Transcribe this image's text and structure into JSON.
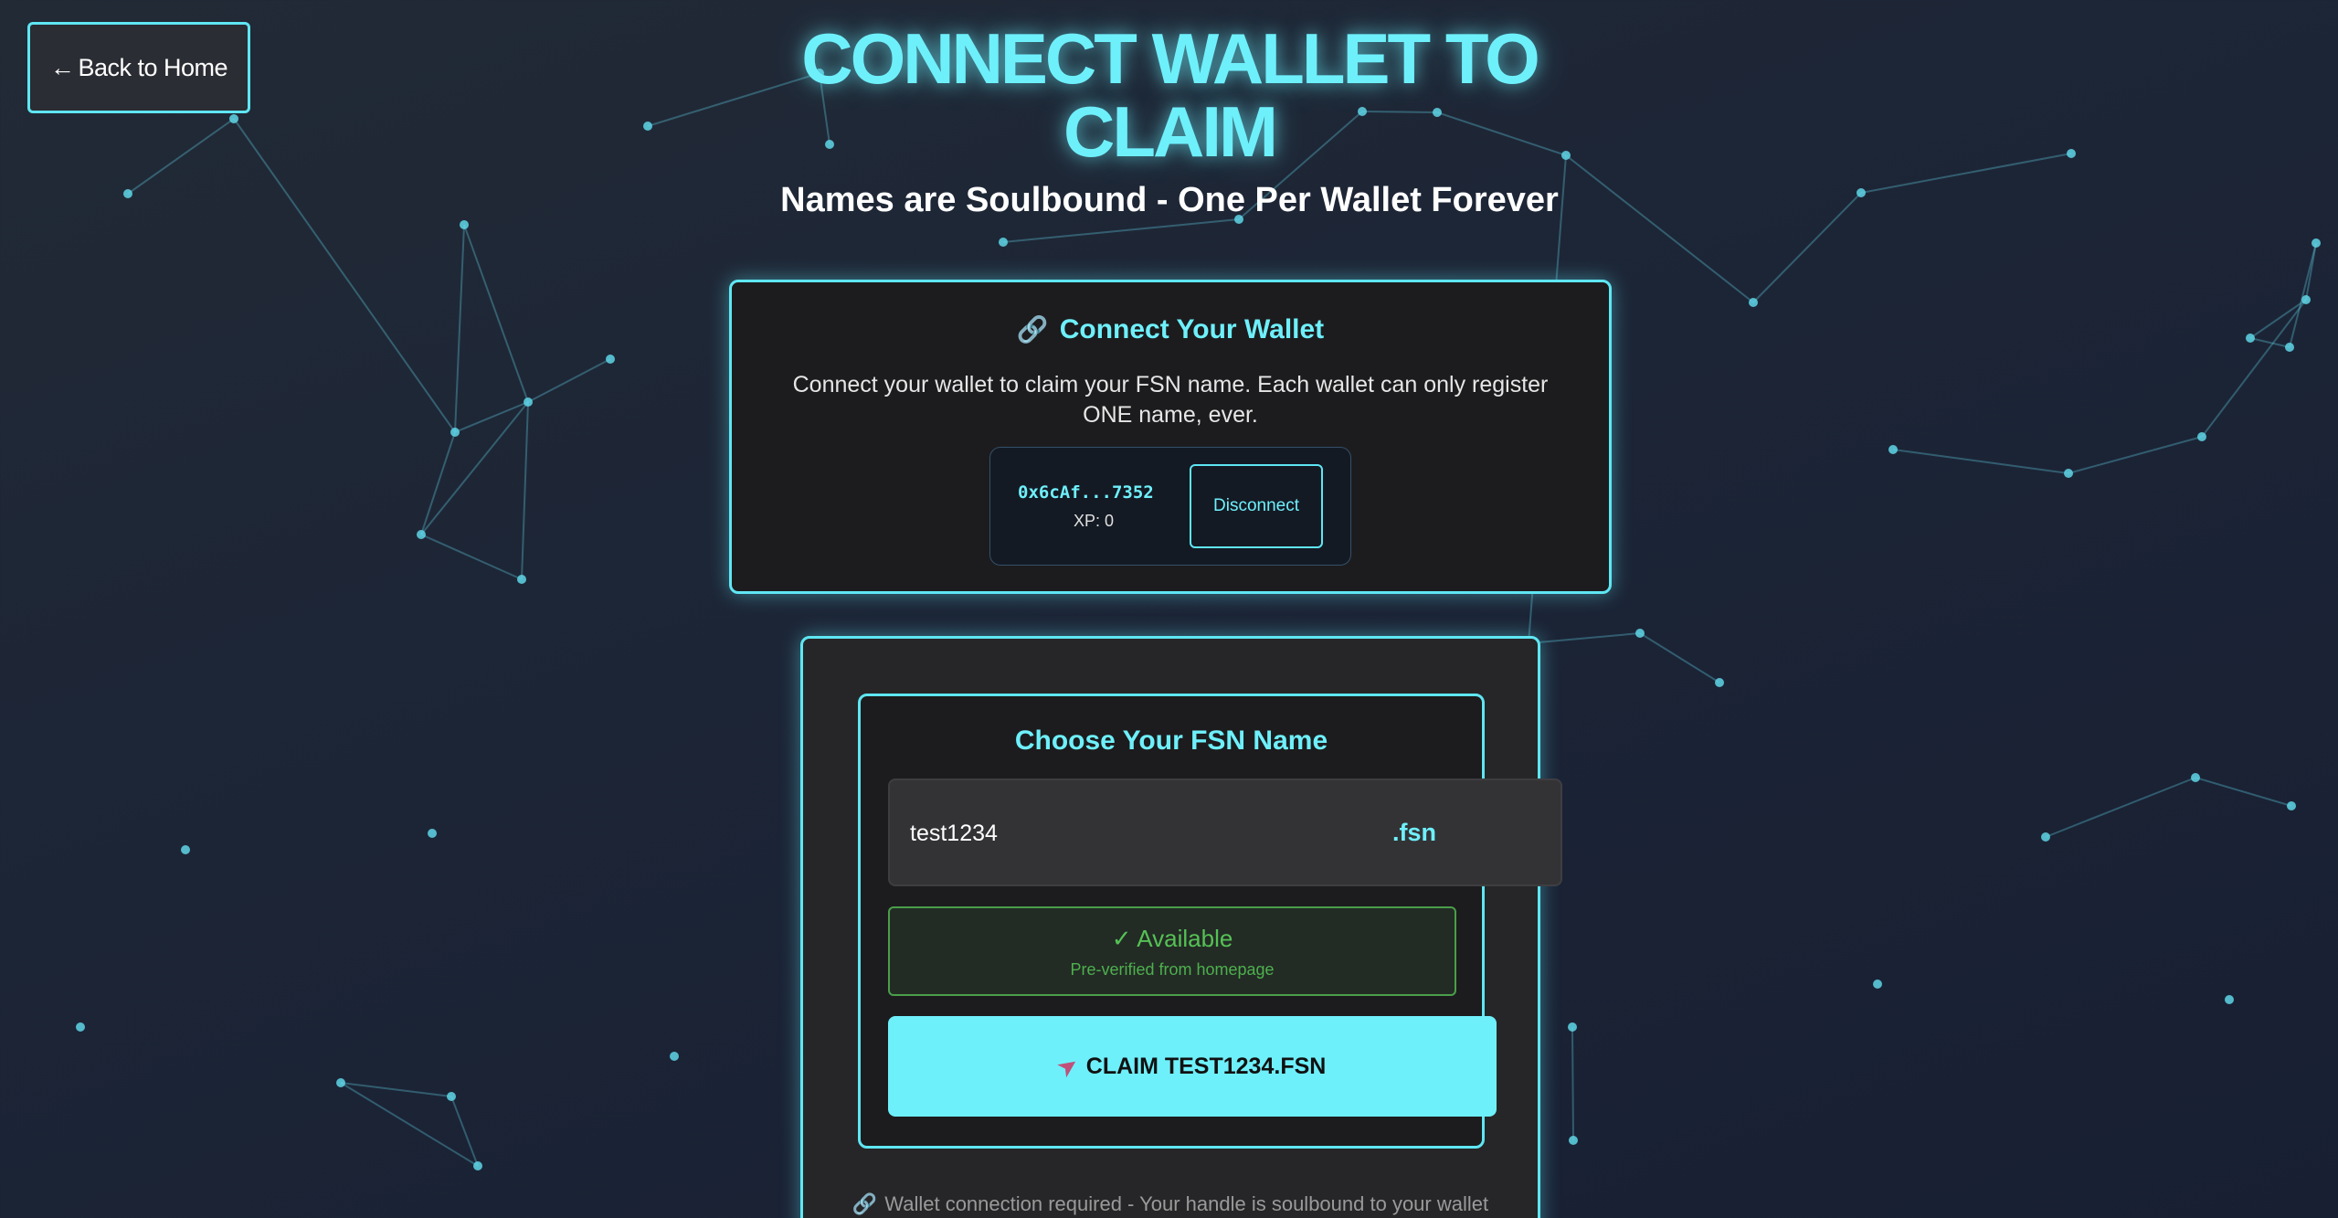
{
  "nav": {
    "back_arrow": "←",
    "back_label": "Back to Home"
  },
  "header": {
    "title": "CONNECT WALLET TO CLAIM",
    "subtitle": "Names are Soulbound - One Per Wallet Forever"
  },
  "wallet": {
    "icon": "link-icon",
    "heading": "Connect Your Wallet",
    "description": "Connect your wallet to claim your FSN name. Each wallet can only register ONE name, ever.",
    "address": "0x6cAf...7352",
    "xp": "XP: 0",
    "disconnect_label": "Disconnect"
  },
  "claim": {
    "heading": "Choose Your FSN Name",
    "input_value": "test1234",
    "suffix": ".fsn",
    "status_text": "✓ Available",
    "status_sub": "Pre-verified from homepage",
    "button_icon": "rocket-icon",
    "button_label": "CLAIM TEST1234.FSN",
    "footnote": "Wallet connection required - Your handle is soulbound to your wallet"
  },
  "colors": {
    "accent": "#6ef0fb",
    "success": "#55c155",
    "background": "#1c2536",
    "card": "#1c1c1e"
  }
}
